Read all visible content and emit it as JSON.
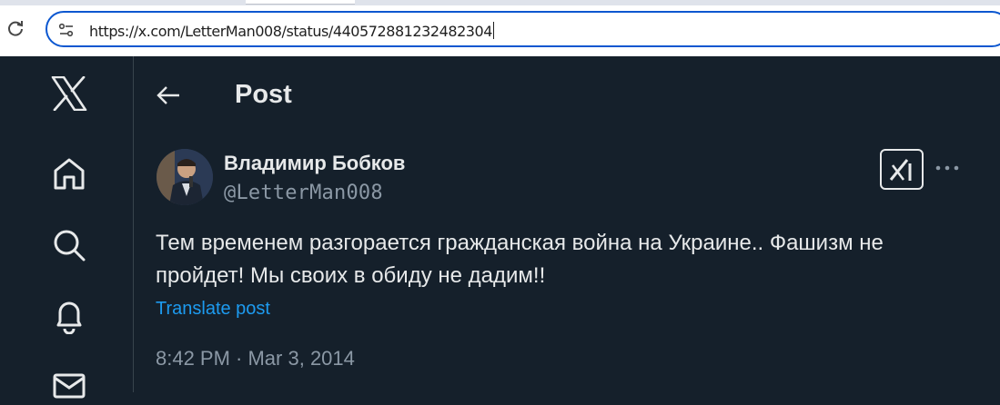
{
  "browser": {
    "url": "https://x.com/LetterMan008/status/440572881232482304"
  },
  "nav": {
    "items": [
      {
        "icon": "x-logo-icon"
      },
      {
        "icon": "home-icon"
      },
      {
        "icon": "search-icon"
      },
      {
        "icon": "bell-icon"
      },
      {
        "icon": "mail-icon"
      }
    ]
  },
  "header": {
    "title": "Post"
  },
  "post": {
    "author_name": "Владимир Бобков",
    "author_handle": "@LetterMan008",
    "text_line1": "Тем временем разгорается гражданская война на Украине.. Фашизм не",
    "text_line2": "пройдет! Мы своих в обиду не дадим!!",
    "translate_label": "Translate post",
    "timestamp": "8:42 PM · Mar 3, 2014"
  },
  "colors": {
    "background": "#15202b",
    "text": "#e7e9ea",
    "secondary": "#8b98a5",
    "accent": "#1d9bf0",
    "border": "#38444d"
  }
}
